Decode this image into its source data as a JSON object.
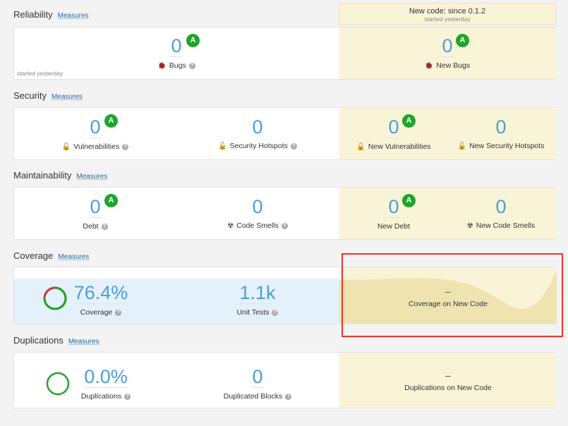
{
  "new_code": {
    "title": "New code: since 0.1.2",
    "subtitle": "started yesterday"
  },
  "reliability": {
    "title": "Reliability",
    "measures": "Measures",
    "started": "started yesterday",
    "bugs": {
      "value": "0",
      "label": "Bugs",
      "rating": "A"
    },
    "new_bugs": {
      "value": "0",
      "label": "New Bugs",
      "rating": "A"
    }
  },
  "security": {
    "title": "Security",
    "measures": "Measures",
    "vulnerabilities": {
      "value": "0",
      "label": "Vulnerabilities",
      "rating": "A"
    },
    "hotspots": {
      "value": "0",
      "label": "Security Hotspots"
    },
    "new_vulnerabilities": {
      "value": "0",
      "label": "New Vulnerabilities",
      "rating": "A"
    },
    "new_hotspots": {
      "value": "0",
      "label": "New Security Hotspots"
    }
  },
  "maintainability": {
    "title": "Maintainability",
    "measures": "Measures",
    "debt": {
      "value": "0",
      "label": "Debt",
      "rating": "A"
    },
    "code_smells": {
      "value": "0",
      "label": "Code Smells"
    },
    "new_debt": {
      "value": "0",
      "label": "New Debt",
      "rating": "A"
    },
    "new_code_smells": {
      "value": "0",
      "label": "New Code Smells"
    }
  },
  "coverage": {
    "title": "Coverage",
    "measures": "Measures",
    "coverage": {
      "value": "76.4%",
      "label": "Coverage",
      "percent": 76.4
    },
    "unit_tests": {
      "value": "1.1k",
      "label": "Unit Tests"
    },
    "new_coverage": {
      "value": "–",
      "label": "Coverage on New Code"
    }
  },
  "duplications": {
    "title": "Duplications",
    "measures": "Measures",
    "duplications": {
      "value": "0.0%",
      "label": "Duplications"
    },
    "blocks": {
      "value": "0",
      "label": "Duplicated Blocks"
    },
    "new_duplications": {
      "value": "–",
      "label": "Duplications on New Code"
    }
  },
  "colors": {
    "accent": "#4b9fd5",
    "rating_a": "#1ea52b",
    "new_code_bg": "#f9f3d8",
    "highlight": "#e8352e"
  }
}
